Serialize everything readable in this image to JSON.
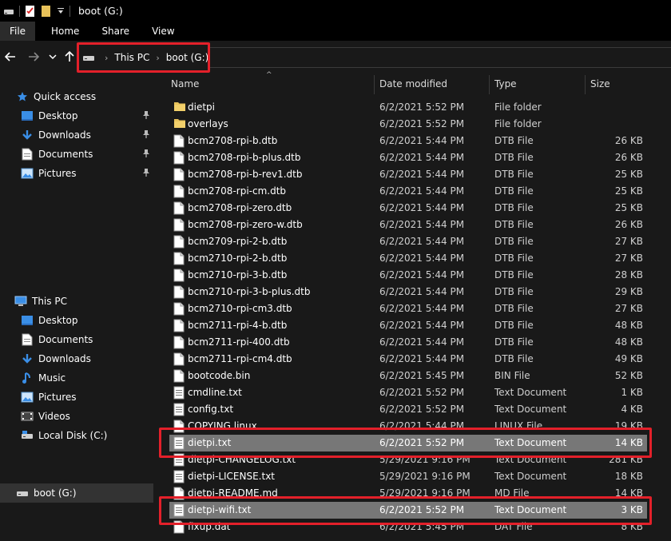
{
  "window": {
    "title": "boot (G:)"
  },
  "ribbon": {
    "tabs": [
      "File",
      "Home",
      "Share",
      "View"
    ]
  },
  "address": {
    "crumbs": [
      "This PC",
      "boot (G:)"
    ]
  },
  "columns": {
    "name": "Name",
    "date": "Date modified",
    "type": "Type",
    "size": "Size"
  },
  "nav": {
    "quick_access": "Quick access",
    "quick_items": [
      "Desktop",
      "Downloads",
      "Documents",
      "Pictures"
    ],
    "this_pc": "This PC",
    "pc_items": [
      "Desktop",
      "Documents",
      "Downloads",
      "Music",
      "Pictures",
      "Videos",
      "Local Disk (C:)"
    ],
    "drive": "boot (G:)"
  },
  "files": [
    {
      "name": "dietpi",
      "date": "6/2/2021 5:52 PM",
      "type": "File folder",
      "size": "",
      "icon": "folder-icon",
      "selected": false
    },
    {
      "name": "overlays",
      "date": "6/2/2021 5:52 PM",
      "type": "File folder",
      "size": "",
      "icon": "folder-icon",
      "selected": false
    },
    {
      "name": "bcm2708-rpi-b.dtb",
      "date": "6/2/2021 5:44 PM",
      "type": "DTB File",
      "size": "26 KB",
      "icon": "file-icon",
      "selected": false
    },
    {
      "name": "bcm2708-rpi-b-plus.dtb",
      "date": "6/2/2021 5:44 PM",
      "type": "DTB File",
      "size": "26 KB",
      "icon": "file-icon",
      "selected": false
    },
    {
      "name": "bcm2708-rpi-b-rev1.dtb",
      "date": "6/2/2021 5:44 PM",
      "type": "DTB File",
      "size": "25 KB",
      "icon": "file-icon",
      "selected": false
    },
    {
      "name": "bcm2708-rpi-cm.dtb",
      "date": "6/2/2021 5:44 PM",
      "type": "DTB File",
      "size": "25 KB",
      "icon": "file-icon",
      "selected": false
    },
    {
      "name": "bcm2708-rpi-zero.dtb",
      "date": "6/2/2021 5:44 PM",
      "type": "DTB File",
      "size": "25 KB",
      "icon": "file-icon",
      "selected": false
    },
    {
      "name": "bcm2708-rpi-zero-w.dtb",
      "date": "6/2/2021 5:44 PM",
      "type": "DTB File",
      "size": "26 KB",
      "icon": "file-icon",
      "selected": false
    },
    {
      "name": "bcm2709-rpi-2-b.dtb",
      "date": "6/2/2021 5:44 PM",
      "type": "DTB File",
      "size": "27 KB",
      "icon": "file-icon",
      "selected": false
    },
    {
      "name": "bcm2710-rpi-2-b.dtb",
      "date": "6/2/2021 5:44 PM",
      "type": "DTB File",
      "size": "27 KB",
      "icon": "file-icon",
      "selected": false
    },
    {
      "name": "bcm2710-rpi-3-b.dtb",
      "date": "6/2/2021 5:44 PM",
      "type": "DTB File",
      "size": "28 KB",
      "icon": "file-icon",
      "selected": false
    },
    {
      "name": "bcm2710-rpi-3-b-plus.dtb",
      "date": "6/2/2021 5:44 PM",
      "type": "DTB File",
      "size": "29 KB",
      "icon": "file-icon",
      "selected": false
    },
    {
      "name": "bcm2710-rpi-cm3.dtb",
      "date": "6/2/2021 5:44 PM",
      "type": "DTB File",
      "size": "27 KB",
      "icon": "file-icon",
      "selected": false
    },
    {
      "name": "bcm2711-rpi-4-b.dtb",
      "date": "6/2/2021 5:44 PM",
      "type": "DTB File",
      "size": "48 KB",
      "icon": "file-icon",
      "selected": false
    },
    {
      "name": "bcm2711-rpi-400.dtb",
      "date": "6/2/2021 5:44 PM",
      "type": "DTB File",
      "size": "48 KB",
      "icon": "file-icon",
      "selected": false
    },
    {
      "name": "bcm2711-rpi-cm4.dtb",
      "date": "6/2/2021 5:44 PM",
      "type": "DTB File",
      "size": "49 KB",
      "icon": "file-icon",
      "selected": false
    },
    {
      "name": "bootcode.bin",
      "date": "6/2/2021 5:45 PM",
      "type": "BIN File",
      "size": "52 KB",
      "icon": "file-icon",
      "selected": false
    },
    {
      "name": "cmdline.txt",
      "date": "6/2/2021 5:52 PM",
      "type": "Text Document",
      "size": "1 KB",
      "icon": "text-file-icon",
      "selected": false
    },
    {
      "name": "config.txt",
      "date": "6/2/2021 5:52 PM",
      "type": "Text Document",
      "size": "4 KB",
      "icon": "text-file-icon",
      "selected": false
    },
    {
      "name": "COPYING.linux",
      "date": "6/2/2021 5:44 PM",
      "type": "LINUX File",
      "size": "19 KB",
      "icon": "file-icon",
      "selected": false
    },
    {
      "name": "dietpi.txt",
      "date": "6/2/2021 5:52 PM",
      "type": "Text Document",
      "size": "14 KB",
      "icon": "text-file-icon",
      "selected": true
    },
    {
      "name": "dietpi-CHANGELOG.txt",
      "date": "5/29/2021 9:16 PM",
      "type": "Text Document",
      "size": "281 KB",
      "icon": "text-file-icon",
      "selected": false
    },
    {
      "name": "dietpi-LICENSE.txt",
      "date": "5/29/2021 9:16 PM",
      "type": "Text Document",
      "size": "18 KB",
      "icon": "text-file-icon",
      "selected": false
    },
    {
      "name": "dietpi-README.md",
      "date": "5/29/2021 9:16 PM",
      "type": "MD File",
      "size": "14 KB",
      "icon": "file-icon",
      "selected": false
    },
    {
      "name": "dietpi-wifi.txt",
      "date": "6/2/2021 5:52 PM",
      "type": "Text Document",
      "size": "3 KB",
      "icon": "text-file-icon",
      "selected": true
    },
    {
      "name": "fixup.dat",
      "date": "6/2/2021 5:45 PM",
      "type": "DAT File",
      "size": "8 KB",
      "icon": "file-icon",
      "selected": false
    }
  ],
  "colors": {
    "highlight": "#e3202a",
    "folder": "#e8c25a",
    "accent": "#3a8ee6"
  }
}
